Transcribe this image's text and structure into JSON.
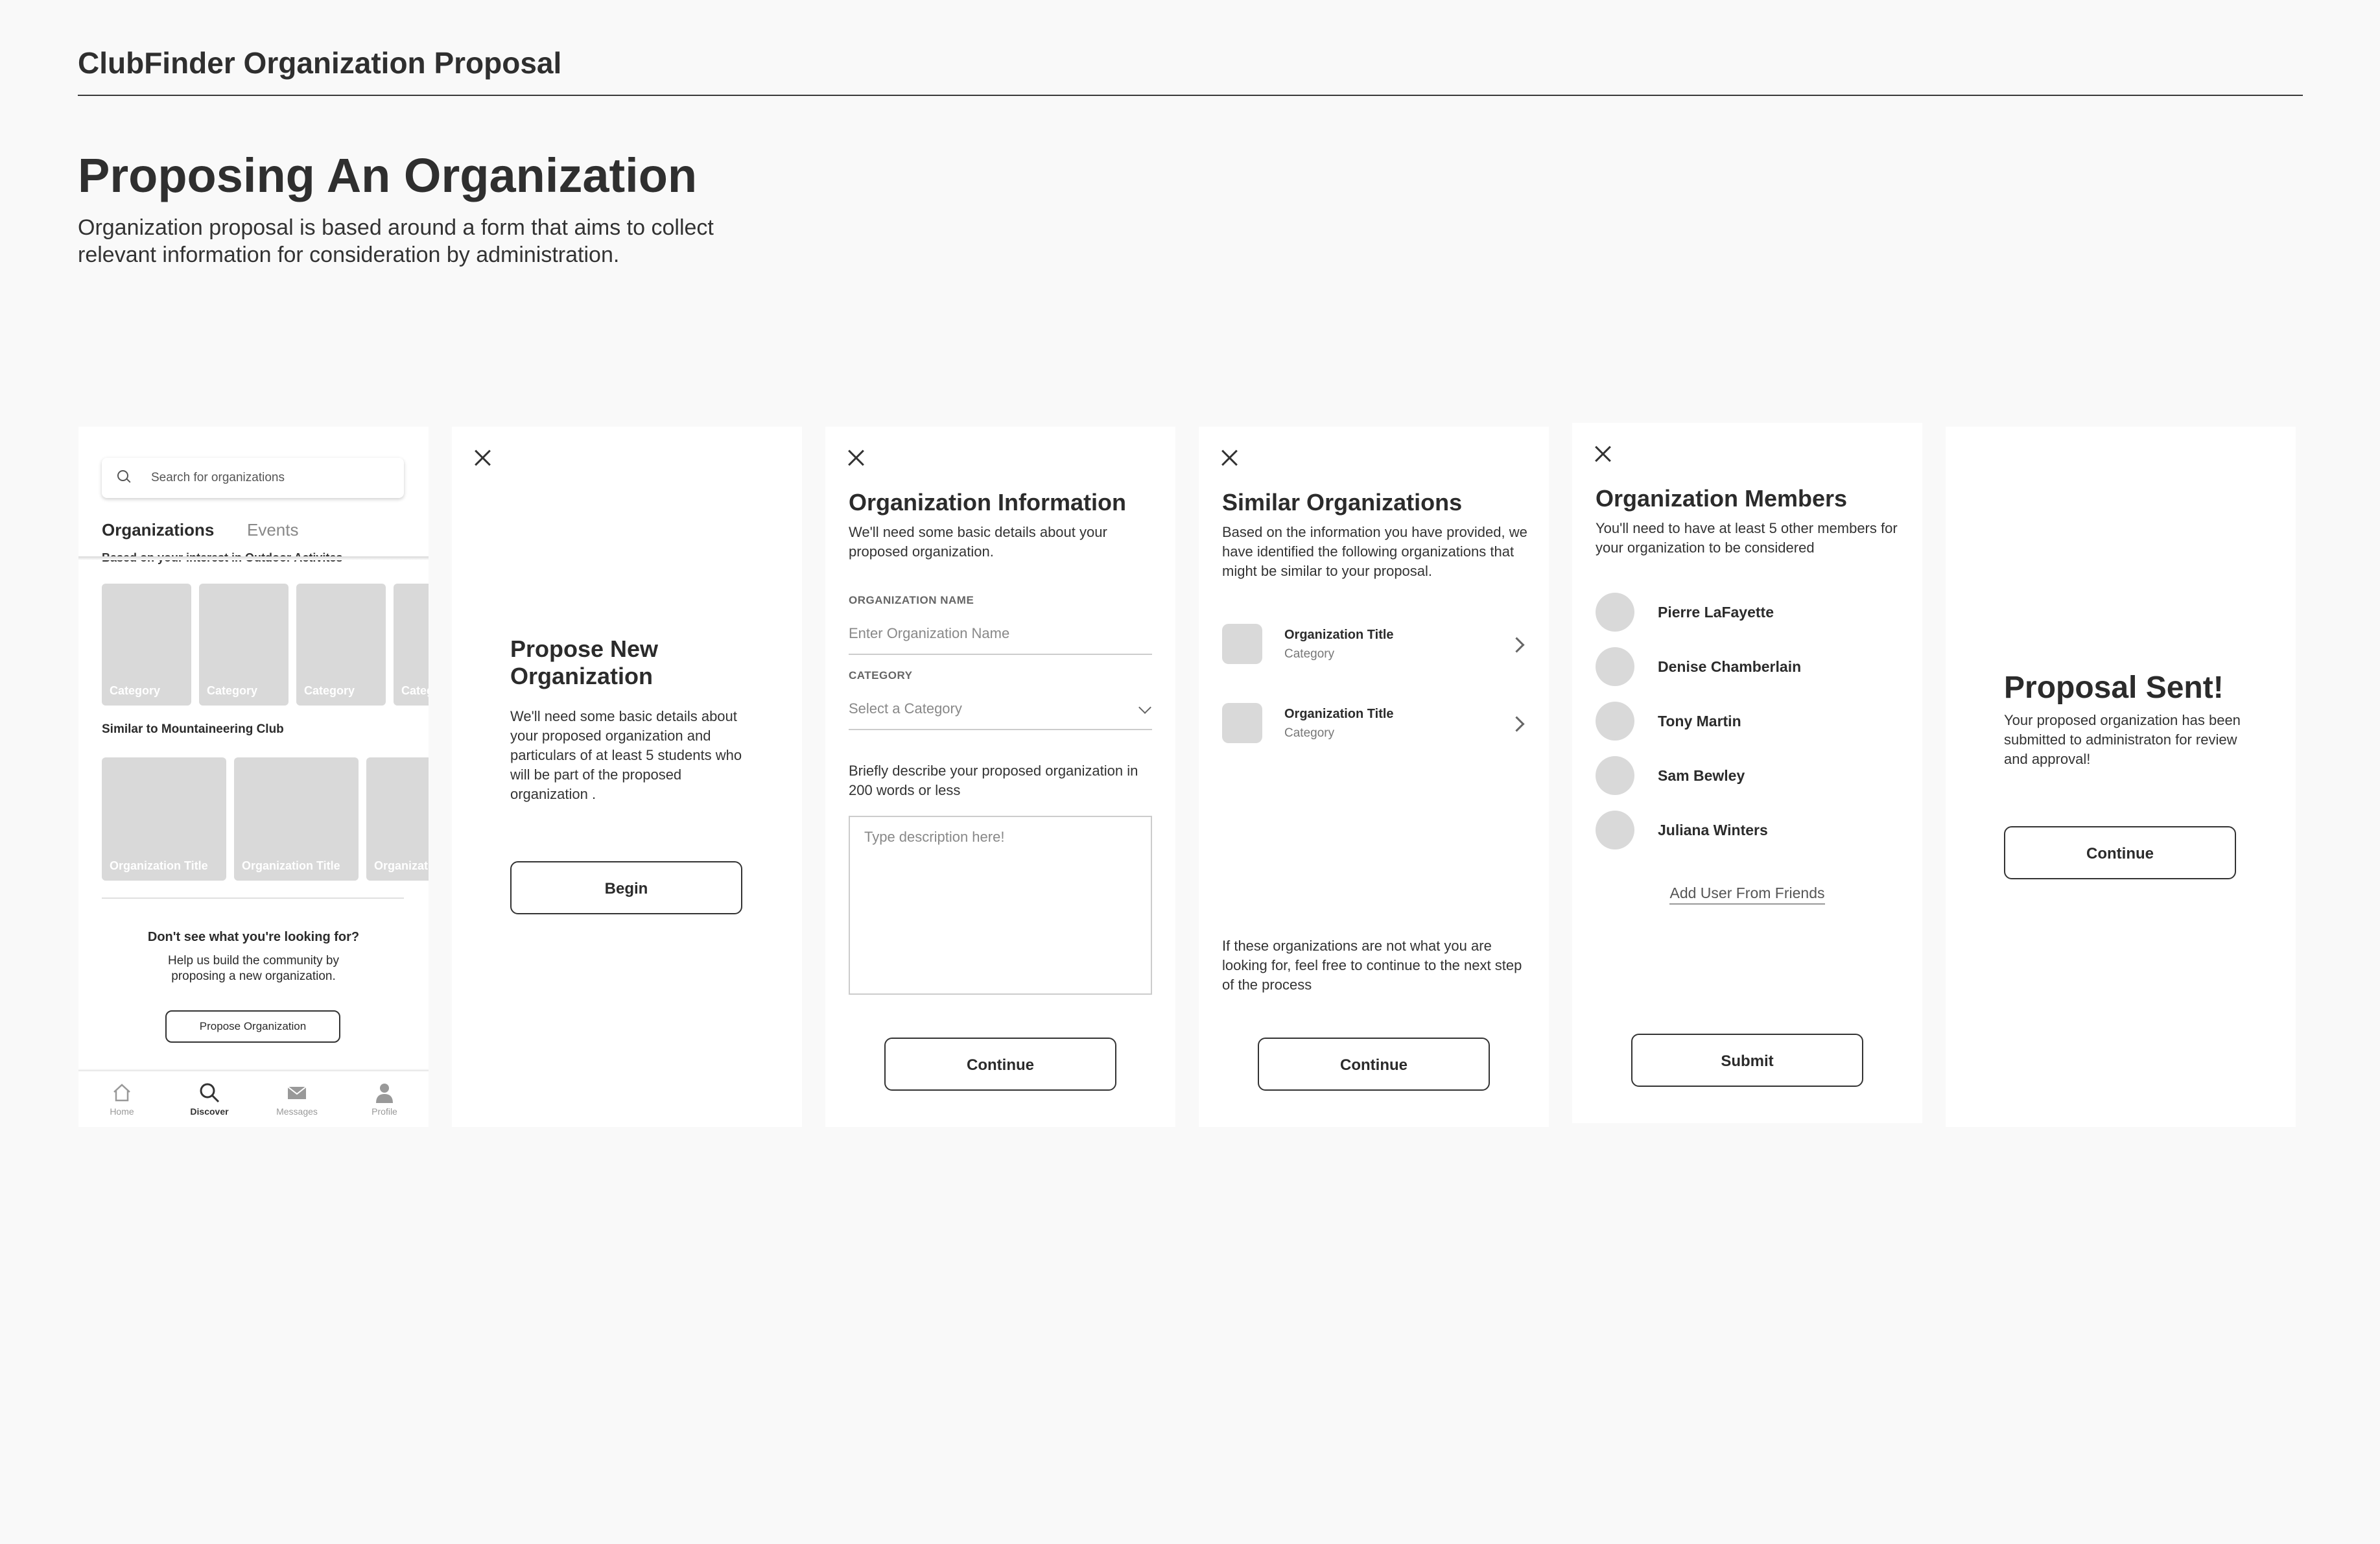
{
  "doc": {
    "title": "ClubFinder Organization Proposal",
    "section_title": "Proposing An Organization",
    "section_desc": "Organization proposal is based around a form that aims to collect relevant information for consideration by administration."
  },
  "discover": {
    "search_placeholder": "Search for organizations",
    "tabs": [
      "Organizations",
      "Events"
    ],
    "interest_label": "Based on your interest in Outdoor Activites",
    "category_tiles": [
      "Category",
      "Category",
      "Category",
      "Category"
    ],
    "similar_label": "Similar to Mountaineering Club",
    "org_tiles": [
      "Organization Title",
      "Organization Title",
      "Organization Title"
    ],
    "cta_title": "Don't see what you're looking for?",
    "cta_sub": "Help us build the community by proposing a new organization.",
    "propose_button": "Propose Organization",
    "nav": [
      "Home",
      "Discover",
      "Messages",
      "Profile"
    ]
  },
  "propose": {
    "title": "Propose New Organization",
    "body": "We'll need some basic details about your proposed organization and particulars of at least 5 students who will be part of the proposed organization .",
    "button": "Begin"
  },
  "info": {
    "title": "Organization Information",
    "subtitle": "We'll need some basic details about your proposed organization.",
    "name_label": "ORGANIZATION NAME",
    "name_placeholder": "Enter Organization Name",
    "category_label": "CATEGORY",
    "category_placeholder": "Select a Category",
    "describe_prompt": "Briefly describe your proposed organization in 200 words or less",
    "description_placeholder": "Type description here!",
    "button": "Continue"
  },
  "similar": {
    "title": "Similar Organizations",
    "subtitle": "Based on the information you have provided, we have identified the following organizations that might be similar to your proposal.",
    "orgs": [
      {
        "title": "Organization Title",
        "category": "Category"
      },
      {
        "title": "Organization Title",
        "category": "Category"
      }
    ],
    "footer_note": "If these organizations are not what you are looking for, feel free to continue to the next step of the process",
    "button": "Continue"
  },
  "members": {
    "title": "Organization Members",
    "subtitle": "You'll need to have at least 5 other members for your organization to be considered",
    "list": [
      "Pierre LaFayette",
      "Denise Chamberlain",
      "Tony Martin",
      "Sam Bewley",
      "Juliana Winters"
    ],
    "add_link": "Add User From Friends",
    "button": "Submit"
  },
  "sent": {
    "title": "Proposal Sent!",
    "body": "Your proposed organization has been submitted to administraton for review and approval!",
    "button": "Continue"
  }
}
